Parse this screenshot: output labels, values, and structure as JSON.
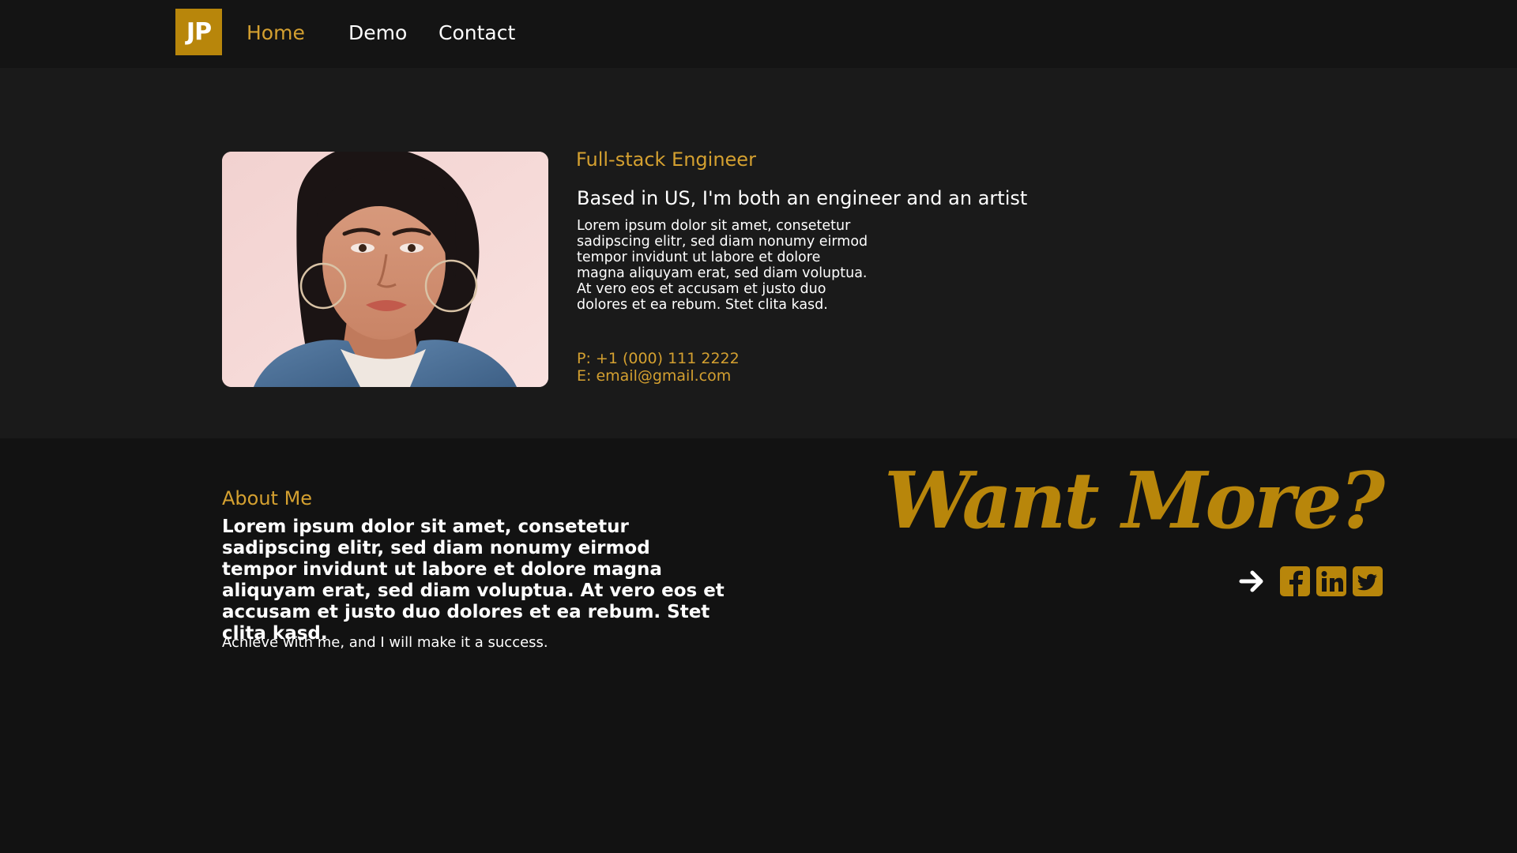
{
  "nav": {
    "logo": "JP",
    "links": [
      {
        "label": "Home",
        "active": true
      },
      {
        "label": "Demo",
        "active": false
      },
      {
        "label": "Contact",
        "active": false
      }
    ]
  },
  "hero": {
    "role": "Full-stack Engineer",
    "headline": "Based in US, I'm both an engineer and an artist",
    "body": "Lorem ipsum dolor sit amet, consetetur sadipscing elitr, sed diam nonumy eirmod tempor invidunt ut labore et dolore magna aliquyam erat, sed diam voluptua. At vero eos et accusam et justo duo dolores et ea rebum. Stet clita kasd.",
    "phone": "P: +1 (000) 111 2222",
    "email": "E: email@gmail.com",
    "image_icon": "portrait-photo"
  },
  "about": {
    "heading": "About Me",
    "lead": "Lorem ipsum dolor sit amet, consetetur sadipscing elitr, sed diam nonumy eirmod tempor invidunt ut labore et dolore magna aliquyam erat, sed diam voluptua. At vero eos et accusam et justo duo dolores et ea rebum. Stet clita kasd.",
    "note": "Achieve with me, and I will make it a success."
  },
  "cta": {
    "title": "Want More?",
    "icons": [
      "arrow-right-icon",
      "facebook-icon",
      "linkedin-icon",
      "twitter-icon"
    ]
  },
  "colors": {
    "accent": "#b8860b",
    "accent_text": "#d4a030",
    "background": "#121212",
    "hero_background": "#1a1a1a"
  }
}
